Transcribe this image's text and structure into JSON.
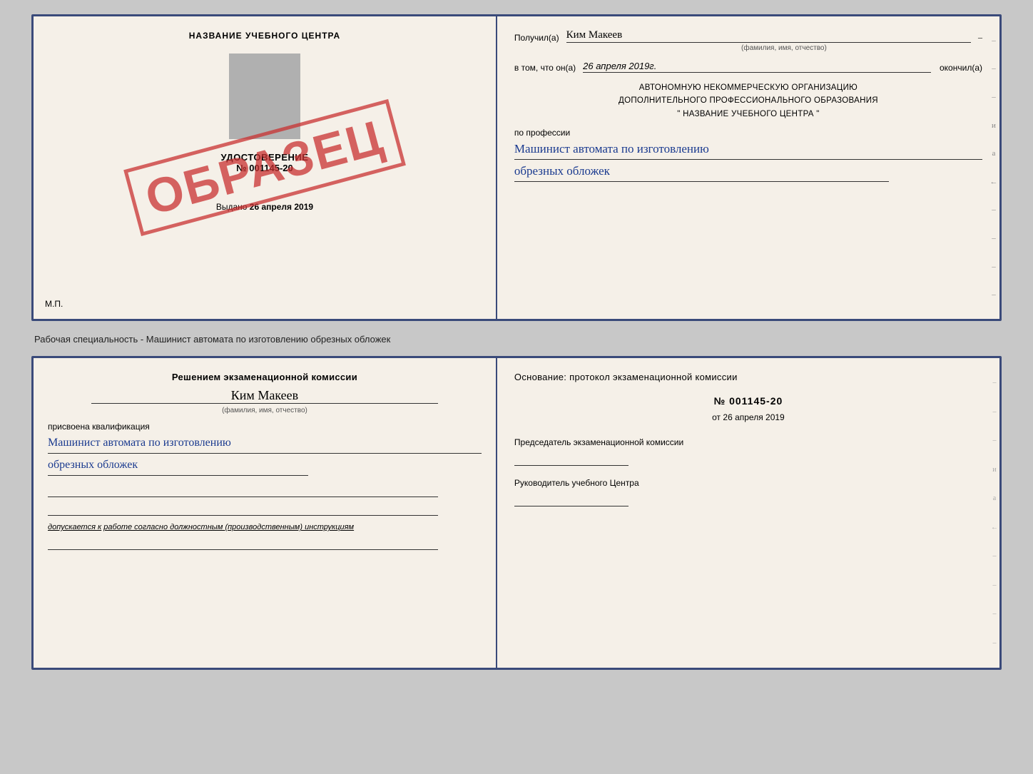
{
  "page": {
    "background": "#c8c8c8"
  },
  "cert_top": {
    "left": {
      "title": "НАЗВАНИЕ УЧЕБНОГО ЦЕНТРА",
      "udostoverenie_label": "УДОСТОВЕРЕНИЕ",
      "number": "№ 001145-20",
      "vydano_label": "Выдано",
      "vydano_date": "26 апреля 2019",
      "mp_label": "М.П.",
      "stamp_text": "ОБРАЗЕЦ"
    },
    "right": {
      "poluchil_label": "Получил(а)",
      "poluchil_value": "Ким Макеев",
      "fio_subtext": "(фамилия, имя, отчество)",
      "vtom_label": "в том, что он(а)",
      "vtom_value": "26 апреля 2019г.",
      "okonchil_label": "окончил(а)",
      "org_line1": "АВТОНОМНУЮ НЕКОММЕРЧЕСКУЮ ОРГАНИЗАЦИЮ",
      "org_line2": "ДОПОЛНИТЕЛЬНОГО ПРОФЕССИОНАЛЬНОГО ОБРАЗОВАНИЯ",
      "org_quotes_open": "\"",
      "org_name": "НАЗВАНИЕ УЧЕБНОГО ЦЕНТРА",
      "org_quotes_close": "\"",
      "po_professii": "по профессии",
      "prof_line1": "Машинист автомата по изготовлению",
      "prof_line2": "обрезных обложек"
    }
  },
  "separator": {
    "text": "Рабочая специальность - Машинист автомата по изготовлению обрезных обложек"
  },
  "cert_bottom": {
    "left": {
      "title_line1": "Решением экзаменационной комиссии",
      "name_value": "Ким Макеев",
      "fio_subtext": "(фамилия, имя, отчество)",
      "prisvoena": "присвоена квалификация",
      "qual_line1": "Машинист автомата по изготовлению",
      "qual_line2": "обрезных обложек",
      "dopuskaetsya_label": "допускается к",
      "dopuskaetsya_value": "работе согласно должностным (производственным) инструкциям"
    },
    "right": {
      "osnov_title": "Основание: протокол экзаменационной комиссии",
      "protocol_number": "№ 001145-20",
      "protocol_date_prefix": "от",
      "protocol_date": "26 апреля 2019",
      "predsedatel_title": "Председатель экзаменационной комиссии",
      "rukovoditel_title": "Руководитель учебного Центра"
    }
  },
  "dashes": [
    "-",
    "-",
    "-",
    "и",
    "а",
    "←",
    "-",
    "-",
    "-",
    "-"
  ],
  "dashes2": [
    "-",
    "-",
    "-",
    "и",
    "а",
    "←",
    "-",
    "-",
    "-",
    "-"
  ]
}
